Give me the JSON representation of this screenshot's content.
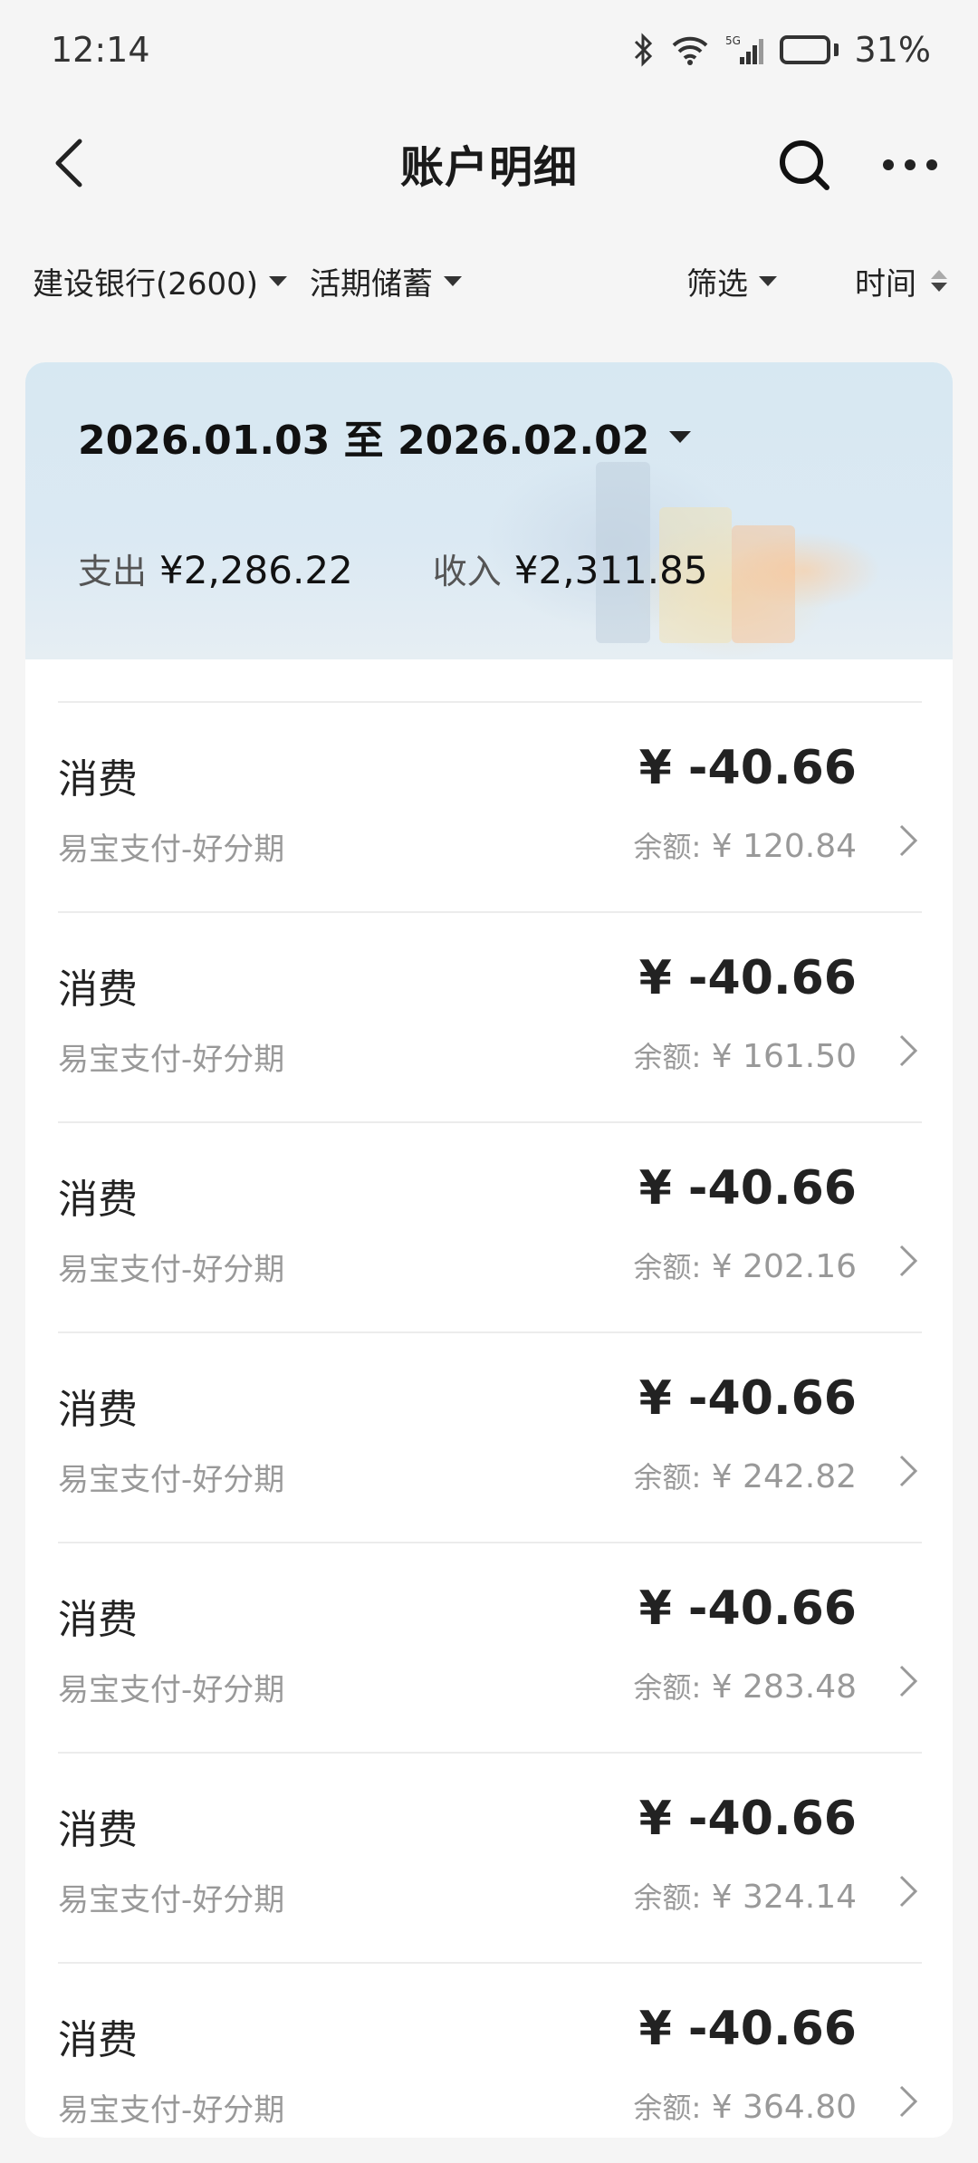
{
  "status_bar": {
    "time": "12:14",
    "network_label": "5G",
    "battery_percent": "31%",
    "battery_level": 0.31
  },
  "header": {
    "title": "账户明细",
    "back_icon": "chevron-left-icon",
    "search_icon": "search-icon",
    "more_icon": "more-dots-icon"
  },
  "filters": {
    "account": "建设银行(2600)",
    "account_type": "活期储蓄",
    "filter": "筛选",
    "sort": "时间"
  },
  "summary": {
    "date_range": "2026.01.03 至 2026.02.02",
    "expense_label": "支出",
    "expense_value": "¥2,286.22",
    "income_label": "收入",
    "income_value": "¥2,311.85"
  },
  "transactions": [
    {
      "type": "消费",
      "merchant": "易宝支付-好分期",
      "amount": "¥ -40.66",
      "balance_label": "余额:",
      "balance": "¥ 120.84"
    },
    {
      "type": "消费",
      "merchant": "易宝支付-好分期",
      "amount": "¥ -40.66",
      "balance_label": "余额:",
      "balance": "¥ 161.50"
    },
    {
      "type": "消费",
      "merchant": "易宝支付-好分期",
      "amount": "¥ -40.66",
      "balance_label": "余额:",
      "balance": "¥ 202.16"
    },
    {
      "type": "消费",
      "merchant": "易宝支付-好分期",
      "amount": "¥ -40.66",
      "balance_label": "余额:",
      "balance": "¥ 242.82"
    },
    {
      "type": "消费",
      "merchant": "易宝支付-好分期",
      "amount": "¥ -40.66",
      "balance_label": "余额:",
      "balance": "¥ 283.48"
    },
    {
      "type": "消费",
      "merchant": "易宝支付-好分期",
      "amount": "¥ -40.66",
      "balance_label": "余额:",
      "balance": "¥ 324.14"
    },
    {
      "type": "消费",
      "merchant": "易宝支付-好分期",
      "amount": "¥ -40.66",
      "balance_label": "余额:",
      "balance": "¥ 364.80"
    }
  ]
}
